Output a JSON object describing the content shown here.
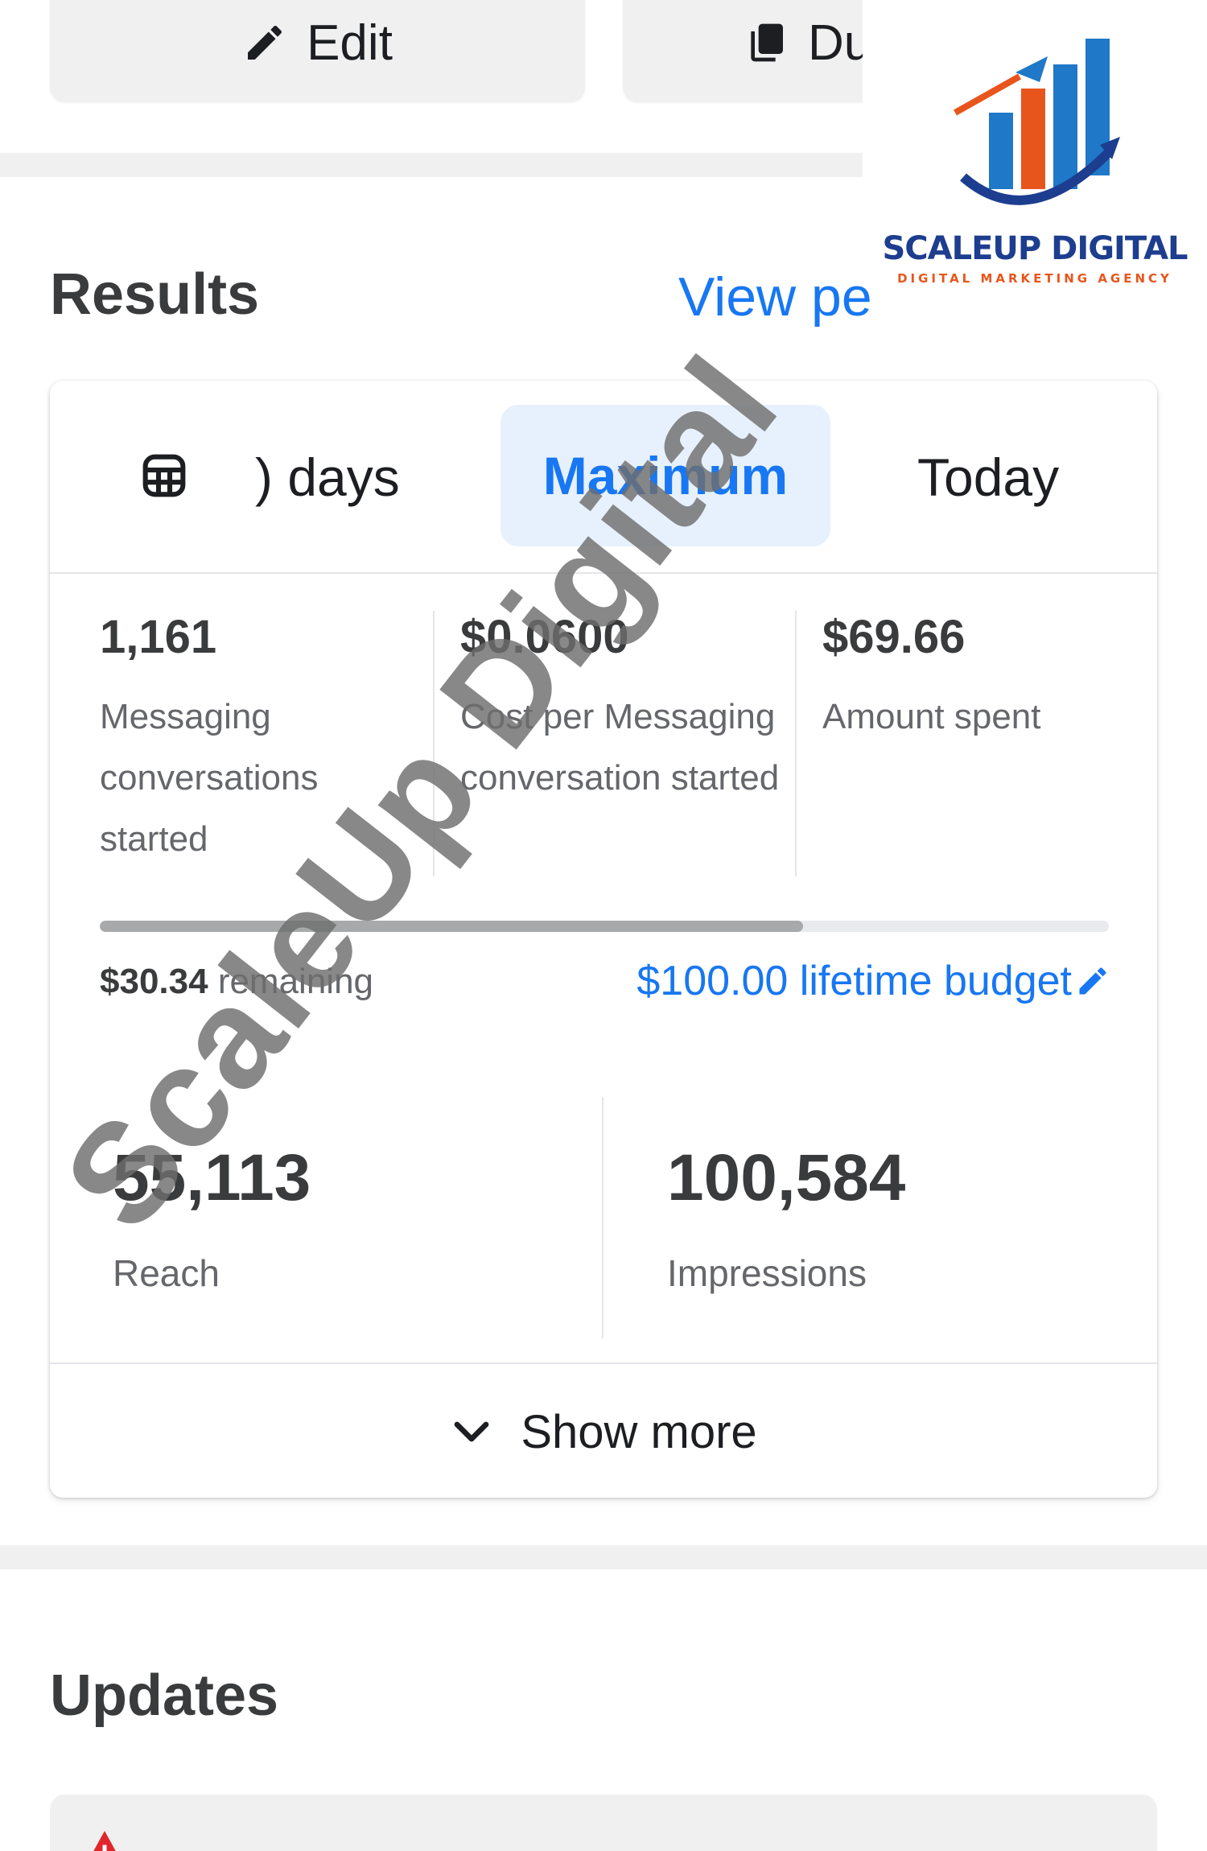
{
  "actions": {
    "edit_label": "Edit",
    "duplicate_label": "Du"
  },
  "logo": {
    "title": "SCALEUP DIGITAL",
    "subtitle": "DIGITAL MARKETING AGENCY"
  },
  "results": {
    "title": "Results",
    "view_link": "View pe"
  },
  "tabs": [
    {
      "label": ") days",
      "icon": "calendar-icon"
    },
    {
      "label": "Maximum",
      "selected": true
    },
    {
      "label": "Today"
    }
  ],
  "metrics": [
    {
      "value": "1,161",
      "label": "Messaging conversations started"
    },
    {
      "value": "$0.0600",
      "label": "Cost per Messaging conversation started"
    },
    {
      "value": "$69.66",
      "label": "Amount spent"
    }
  ],
  "budget": {
    "spent_fraction": 0.6966,
    "remaining_amount": "$30.34",
    "remaining_text": "remaining",
    "lifetime_label": "$100.00 lifetime budget",
    "icon": "pencil-icon"
  },
  "reach": {
    "value": "55,113",
    "label": "Reach"
  },
  "impressions": {
    "value": "100,584",
    "label": "Impressions"
  },
  "show_more_label": "Show more",
  "updates": {
    "title": "Updates",
    "icon": "warning-icon"
  },
  "watermark": "ScaleUp Digital",
  "colors": {
    "accent": "#1877f2",
    "selected_tab_bg": "#e7f1fd",
    "logo_blue": "#1d3e8f",
    "logo_orange": "#e8551c",
    "warning": "#e0262b"
  }
}
